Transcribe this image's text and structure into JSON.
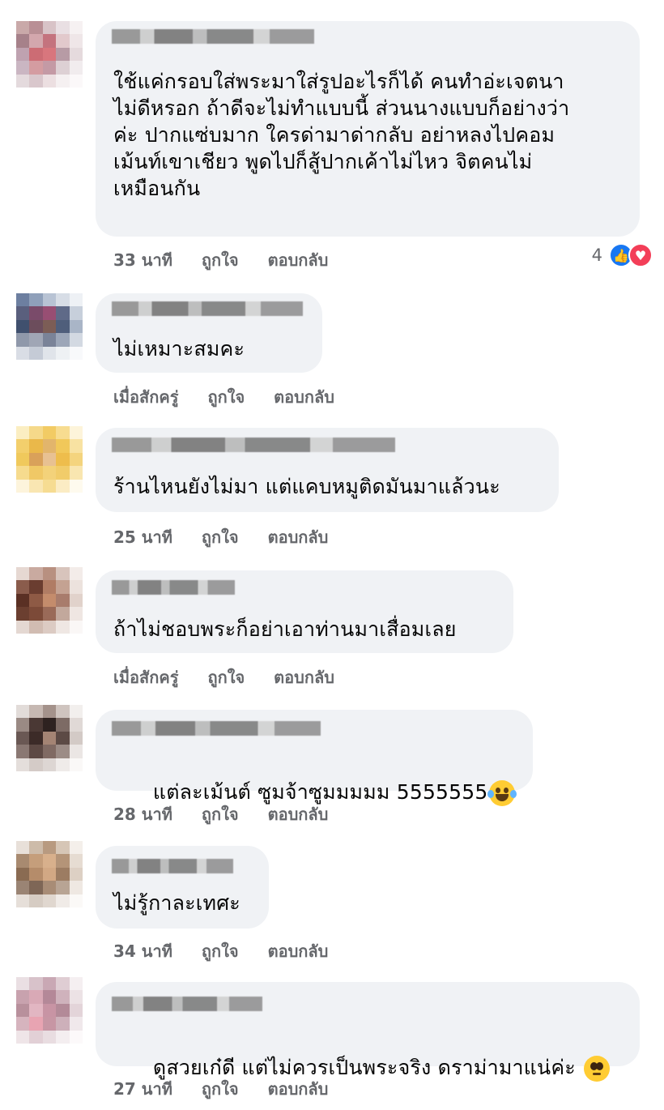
{
  "actions": {
    "like": "ถูกใจ",
    "reply": "ตอบกลับ"
  },
  "colors": {
    "bubble": "#f0f2f5",
    "meta": "#65676b",
    "like": "#1877f2",
    "love": "#f33e58"
  },
  "comments": [
    {
      "text": "ใช้แค่กรอบใส่พระมาใส่รูปอะไรก็ได้ คนทำอ่ะเจตนา\nไม่ดีหรอก ถ้าดีจะไม่ทำแบบนี้ ส่วนนางแบบก็อย่างว่า\nค่ะ ปากแซ่บมาก ใครด่ามาด่ากลับ อย่าหลงไปคอม\nเม้นท์เขาเชียว พูดไปก็สู้ปากเค้าไม่ไหว จิตคนไม่\nเหมือนกัน",
      "time": "33 นาที",
      "reaction_count": "4",
      "reaction_icons": [
        "like-icon",
        "love-icon"
      ]
    },
    {
      "text": "ไม่เหมาะสมคะ",
      "time": "เมื่อสักครู่"
    },
    {
      "text": "ร้านไหนยังไม่มา แต่แคบหมูติดมันมาแล้วนะ",
      "time": "25 นาที"
    },
    {
      "text": "ถ้าไม่ชอบพระก็อย่าเอาท่านมาเสื่อมเลย",
      "time": "เมื่อสักครู่"
    },
    {
      "text": "แต่ละเม้นต์ ซูมจ้าซูมมมมม 5555555",
      "time": "28 นาที",
      "emoji": "laughing-crying-emoji"
    },
    {
      "text": "ไม่รู้กาละเทศะ",
      "time": "34 นาที"
    },
    {
      "text": "ดูสวยเก๋ดี แต่ไม่ควรเป็นพระจริง ดราม่ามาแน่ค่ะ",
      "time": "27 นาที",
      "emoji": "pleading-face-emoji"
    }
  ]
}
